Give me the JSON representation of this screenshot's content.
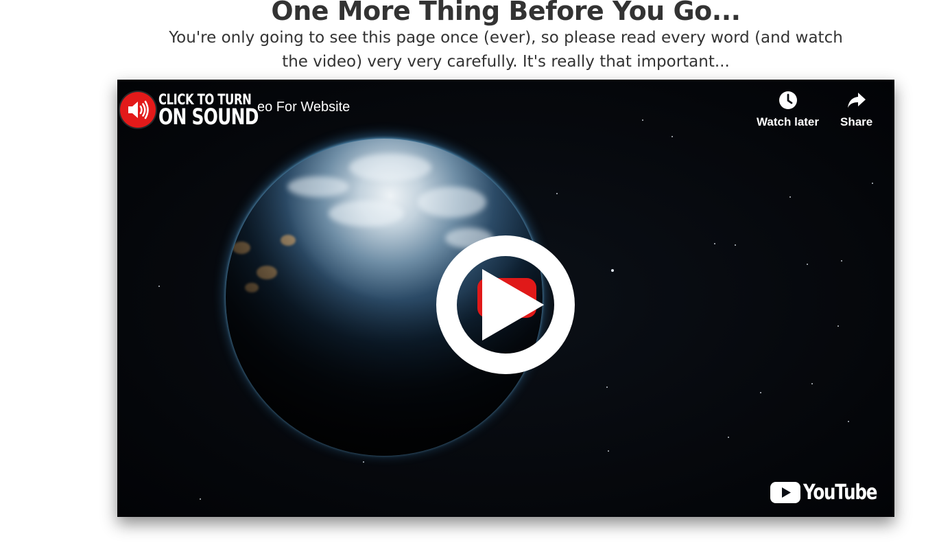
{
  "page": {
    "headline": "One More Thing Before You Go...",
    "subhead": "You're only going to see this page once (ever), so please read every word (and watch the video) very very carefully. It's really that important..."
  },
  "video": {
    "title": "eo For Website",
    "sound_badge": {
      "line1": "CLICK TO TURN",
      "line2": "ON SOUND",
      "icon": "speaker-icon"
    },
    "actions": {
      "watch_later": "Watch later",
      "share": "Share"
    },
    "logo_text": "YouTube",
    "play_icon": "play-icon",
    "colors": {
      "accent_red": "#e31a1a",
      "background": "#04060a"
    }
  }
}
